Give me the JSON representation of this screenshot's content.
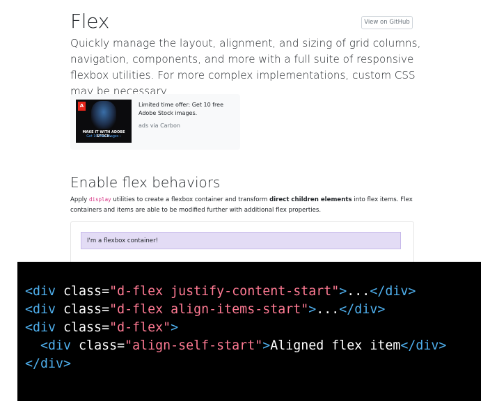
{
  "docs": {
    "title": "Flex",
    "github_button": "View on GitHub",
    "lead": "Quickly manage the layout, alignment, and sizing of grid columns, navigation, components, and more with a full suite of responsive flexbox utilities. For more complex implementations, custom CSS may be necessary."
  },
  "ad": {
    "image_logo": "A",
    "image_tagline": "MAKE IT WITH ADOBE STOCK.",
    "image_cta": "Get 10 free images ›",
    "text": "Limited time offer: Get 10 free Adobe Stock images.",
    "powered_by": "ads via Carbon"
  },
  "section": {
    "title": "Enable flex behaviors",
    "desc_before": "Apply ",
    "desc_code": "display",
    "desc_middle": " utilities to create a flexbox container and transform ",
    "desc_bold": "direct children elements",
    "desc_after": " into flex items. Flex containers and items are able to be modified further with additional flex properties.",
    "example_text": "I'm a flexbox container!"
  },
  "code": {
    "lines": [
      [
        [
          "tag",
          "<div"
        ],
        [
          "attr",
          " class="
        ],
        [
          "str",
          "\"d-flex justify-content-start\""
        ],
        [
          "tag",
          ">"
        ],
        [
          "txt",
          "..."
        ],
        [
          "tag",
          "</div>"
        ]
      ],
      [
        [
          "tag",
          "<div"
        ],
        [
          "attr",
          " class="
        ],
        [
          "str",
          "\"d-flex align-items-start\""
        ],
        [
          "tag",
          ">"
        ],
        [
          "txt",
          "..."
        ],
        [
          "tag",
          "</div>"
        ]
      ],
      [
        [
          "tag",
          "<div"
        ],
        [
          "attr",
          " class="
        ],
        [
          "str",
          "\"d-flex\""
        ],
        [
          "tag",
          ">"
        ]
      ],
      [
        [
          "txt",
          "  "
        ],
        [
          "tag",
          "<div"
        ],
        [
          "attr",
          " class="
        ],
        [
          "str",
          "\"align-self-start\""
        ],
        [
          "tag",
          ">"
        ],
        [
          "txt",
          "Aligned flex item"
        ],
        [
          "tag",
          "</div>"
        ]
      ],
      [
        [
          "tag",
          "</div>"
        ]
      ]
    ]
  }
}
